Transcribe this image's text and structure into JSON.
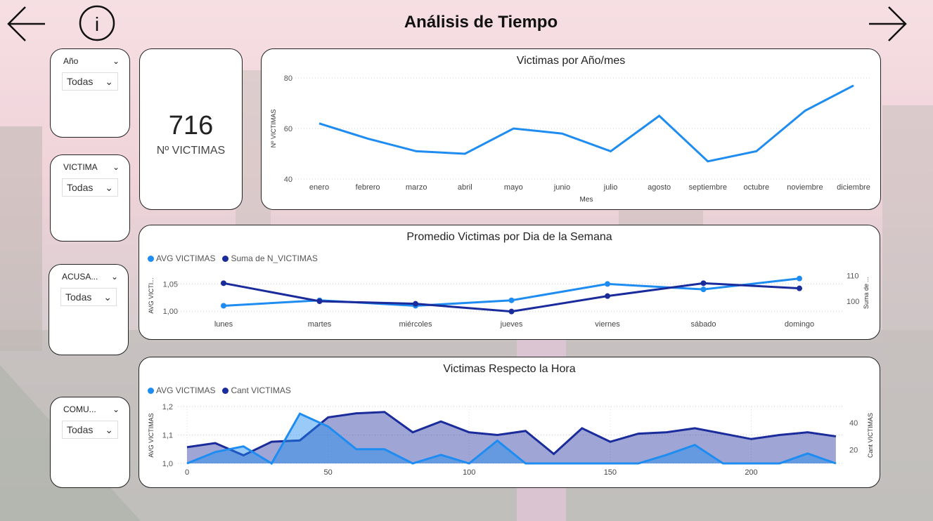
{
  "page": {
    "title": "Análisis de Tiempo"
  },
  "nav": {
    "back_icon": "arrow-left-icon",
    "forward_icon": "arrow-right-icon",
    "info_icon": "info-icon",
    "info_glyph": "i"
  },
  "slicers": [
    {
      "title": "Año",
      "value": "Todas"
    },
    {
      "title": "VICTIMA",
      "value": "Todas"
    },
    {
      "title": "ACUSA...",
      "value": "Todas"
    },
    {
      "title": "COMU...",
      "value": "Todas"
    }
  ],
  "kpi": {
    "value": "716",
    "label": "Nº VICTIMAS"
  },
  "colors": {
    "light_blue": "#1e8cf0",
    "dark_blue": "#1a2b9c"
  },
  "chart_data": [
    {
      "type": "line",
      "title": "Victimas por Año/mes",
      "xlabel": "Mes",
      "ylabel": "Nº VICTIMAS",
      "categories": [
        "enero",
        "febrero",
        "marzo",
        "abril",
        "mayo",
        "junio",
        "julio",
        "agosto",
        "septiembre",
        "octubre",
        "noviembre",
        "diciembre"
      ],
      "values": [
        62,
        56,
        51,
        50,
        60,
        58,
        51,
        65,
        47,
        51,
        67,
        77
      ],
      "ylim": [
        40,
        80
      ],
      "yticks": [
        "40",
        "60",
        "80"
      ],
      "grid": true
    },
    {
      "type": "line",
      "title": "Promedio Victimas por Dia de la Semana",
      "ylabel": "AVG VICTI...",
      "y2label": "Suma de ...",
      "categories": [
        "lunes",
        "martes",
        "miércoles",
        "jueves",
        "viernes",
        "sábado",
        "domingo"
      ],
      "series": [
        {
          "name": "AVG VICTIMAS",
          "values": [
            1.01,
            1.02,
            1.01,
            1.02,
            1.05,
            1.04,
            1.06
          ],
          "axis": "left"
        },
        {
          "name": "Suma de N_VICTIMAS",
          "values": [
            107,
            100,
            99,
            96,
            102,
            107,
            105
          ],
          "axis": "right"
        }
      ],
      "ylim": [
        0.99,
        1.075
      ],
      "y2lim": [
        94,
        112
      ],
      "yticks": [
        "1,00",
        "1,05"
      ],
      "y2ticks": [
        "100",
        "110"
      ],
      "legend": "top-left"
    },
    {
      "type": "area",
      "title": "Victimas Respecto la Hora",
      "ylabel": "AVG VICTIMAS",
      "y2label": "Cant VICTIMAS",
      "x": [
        0,
        10,
        20,
        30,
        40,
        50,
        60,
        70,
        80,
        90,
        100,
        110,
        120,
        130,
        140,
        150,
        160,
        170,
        180,
        190,
        200,
        210,
        220,
        230
      ],
      "series": [
        {
          "name": "AVG VICTIMAS",
          "values": [
            1.0,
            1.04,
            1.06,
            1.0,
            1.175,
            1.13,
            1.05,
            1.05,
            1.0,
            1.03,
            1.0,
            1.08,
            1.0,
            1.0,
            1.0,
            1.0,
            1.0,
            1.03,
            1.065,
            1.0,
            1.0,
            1.0,
            1.035,
            1.0
          ],
          "axis": "left"
        },
        {
          "name": "Cant VICTIMAS",
          "values": [
            22,
            25,
            16,
            26,
            27,
            44,
            47,
            48,
            33,
            41,
            33,
            31,
            34,
            17,
            36,
            26,
            32,
            33,
            36,
            32,
            28,
            31,
            33,
            30
          ],
          "axis": "right"
        }
      ],
      "xlim": [
        0,
        240
      ],
      "ylim": [
        1.0,
        1.2
      ],
      "y2lim": [
        10,
        52
      ],
      "xticks": [
        "0",
        "50",
        "100",
        "150",
        "200"
      ],
      "yticks": [
        "1,0",
        "1,1",
        "1,2"
      ],
      "y2ticks": [
        "20",
        "40"
      ],
      "legend": "top-left"
    }
  ]
}
